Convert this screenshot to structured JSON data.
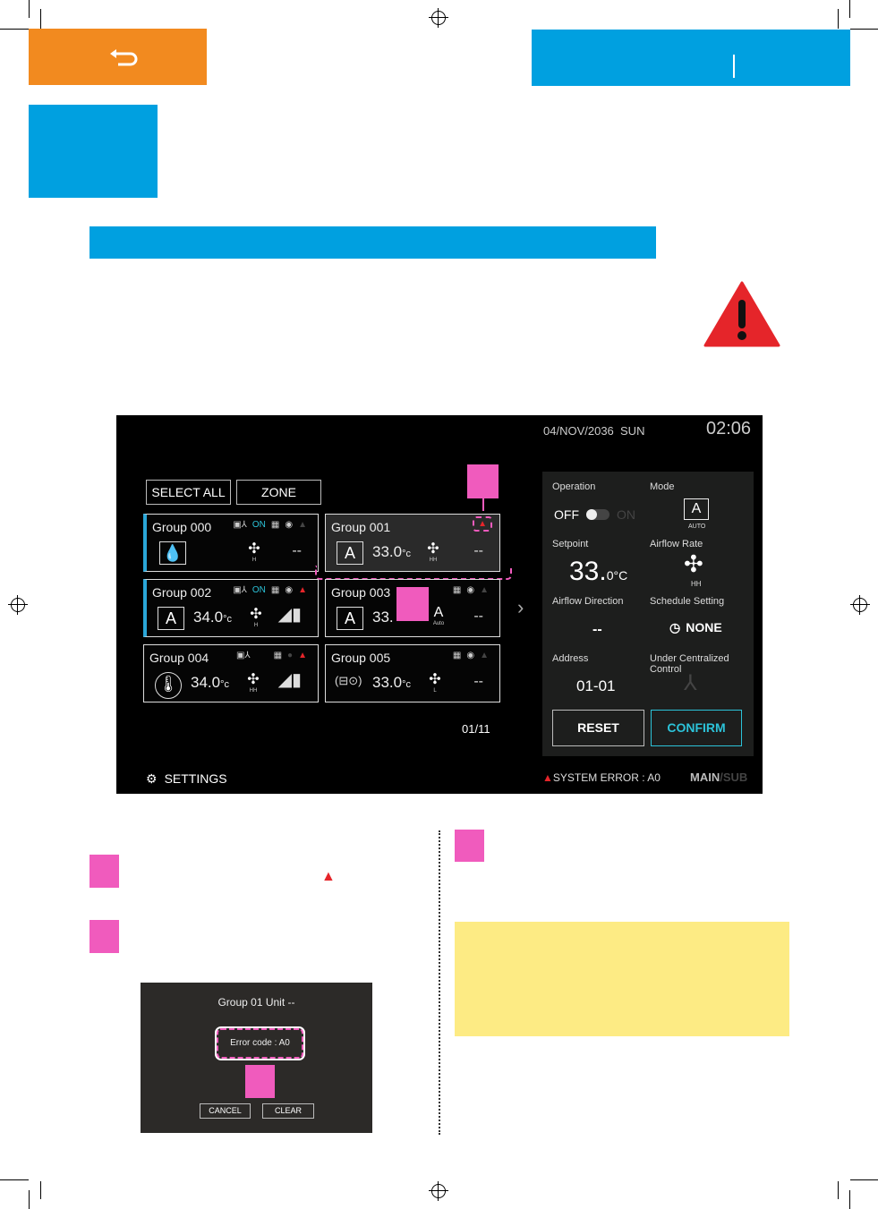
{
  "colors": {
    "orange": "#f28a1f",
    "blue": "#00a0e0",
    "pink": "#f05bbd",
    "yellow": "#fdeb84",
    "alert_red": "#e5252a",
    "cyan": "#2cc3d9"
  },
  "nav": {
    "back_icon": "return-arrow-icon"
  },
  "screen": {
    "date": "04/NOV/2036",
    "day": "SUN",
    "time": "02:06",
    "select_all": "SELECT ALL",
    "zone": "ZONE",
    "groups": [
      {
        "name": "Group 000",
        "on": "ON",
        "temp": "",
        "fan": "H",
        "direction": "--",
        "alert": false
      },
      {
        "name": "Group 001",
        "on": "",
        "temp": "33.0",
        "fan": "HH",
        "direction": "--",
        "alert": true
      },
      {
        "name": "Group 002",
        "on": "ON",
        "temp": "34.0",
        "fan": "H",
        "direction": "",
        "alert": true
      },
      {
        "name": "Group 003",
        "on": "",
        "temp": "33.",
        "fan": "Auto",
        "direction": "--",
        "alert": false
      },
      {
        "name": "Group 004",
        "on": "",
        "temp": "34.0",
        "fan": "HH",
        "direction": "",
        "alert": true
      },
      {
        "name": "Group 005",
        "on": "",
        "temp": "33.0",
        "fan": "L",
        "direction": "--",
        "alert": false
      }
    ],
    "unit": "°c",
    "page": "01/11",
    "settings": "SETTINGS",
    "system_error": "SYSTEM ERROR : A0",
    "main": "MAIN",
    "sub": "/SUB",
    "panel": {
      "operation_label": "Operation",
      "off": "OFF",
      "on": "ON",
      "mode_label": "Mode",
      "mode_value": "AUTO",
      "setpoint_label": "Setpoint",
      "setpoint_int": "33.",
      "setpoint_dec": "0°C",
      "airflow_rate_label": "Airflow Rate",
      "airflow_rate_value": "HH",
      "airflow_direction_label": "Airflow Direction",
      "airflow_direction_value": "--",
      "schedule_label": "Schedule Setting",
      "schedule_value": "NONE",
      "address_label": "Address",
      "address_value": "01-01",
      "central_label": "Under Centralized Control",
      "reset": "RESET",
      "confirm": "CONFIRM"
    }
  },
  "dialog": {
    "title": "Group 01  Unit --",
    "error_code": "Error code : A0",
    "cancel": "CANCEL",
    "clear": "CLEAR"
  }
}
